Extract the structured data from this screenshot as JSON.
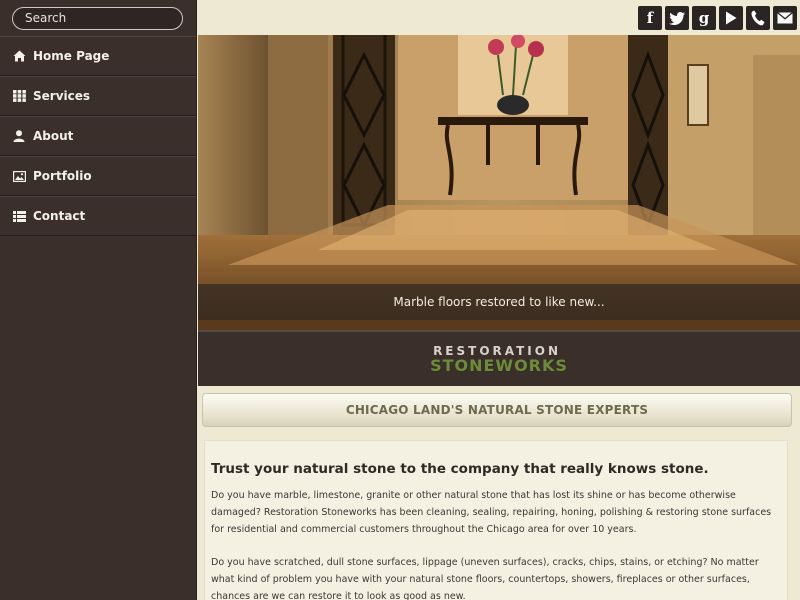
{
  "search": {
    "placeholder": "Search"
  },
  "sidebar": {
    "items": [
      {
        "label": "Home Page",
        "icon": "home-icon"
      },
      {
        "label": "Services",
        "icon": "grid-icon"
      },
      {
        "label": "About",
        "icon": "user-icon"
      },
      {
        "label": "Portfolio",
        "icon": "image-icon"
      },
      {
        "label": "Contact",
        "icon": "list-icon"
      }
    ]
  },
  "social": {
    "facebook": "f",
    "twitter": "twitter-icon",
    "google": "g",
    "youtube": "play-icon",
    "phone": "phone-icon",
    "email": "email-icon"
  },
  "hero": {
    "caption": "Marble floors restored to like new..."
  },
  "logo": {
    "line1": "RESTORATION",
    "line2": "STONEWORKS"
  },
  "heading": {
    "title": "CHICAGO LAND'S NATURAL STONE EXPERTS"
  },
  "content": {
    "headline": "Trust your natural stone to the company that really knows stone.",
    "paragraph1": "Do you have marble, limestone, granite or other natural stone that has lost its shine or has become otherwise damaged? Restoration Stoneworks has been cleaning, sealing, repairing, honing, polishing & restoring stone surfaces for residential and commercial customers throughout the Chicago area for over 10 years.",
    "paragraph2": "Do you have scratched, dull stone surfaces, lippage (uneven surfaces), cracks, chips, stains, or etching? No matter what kind of problem you have with your natural stone floors, countertops, showers, fireplaces or other surfaces, chances are we can restore it to look as good as new."
  },
  "colors": {
    "sidebar_bg": "#3a2f2b",
    "page_bg": "#ede9d2",
    "logo_green": "#6f8a3c"
  }
}
